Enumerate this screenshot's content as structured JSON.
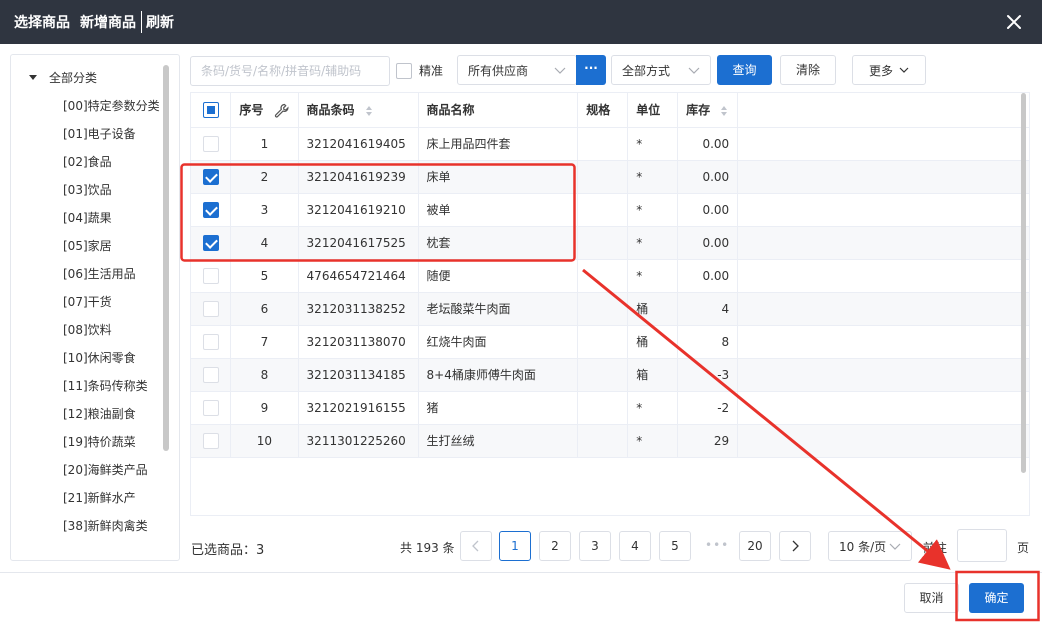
{
  "title": {
    "select": "选择商品",
    "add": "新增商品",
    "refresh": "刷新"
  },
  "sidebar": {
    "root": "全部分类",
    "items": [
      "[00]特定参数分类",
      "[01]电子设备",
      "[02]食品",
      "[03]饮品",
      "[04]蔬果",
      "[05]家居",
      "[06]生活用品",
      "[07]干货",
      "[08]饮料",
      "[10]休闲零食",
      "[11]条码传称类",
      "[12]粮油副食",
      "[19]特价蔬菜",
      "[20]海鲜类产品",
      "[21]新鲜水产",
      "[38]新鲜肉禽类"
    ]
  },
  "toolbar": {
    "search_placeholder": "条码/货号/名称/拼音码/辅助码",
    "exact_label": "精准",
    "supplier": "所有供应商",
    "supplier_more": "···",
    "method": "全部方式",
    "query": "查询",
    "clear": "清除",
    "more": "更多"
  },
  "table": {
    "headers": {
      "seq": "序号",
      "code": "商品条码",
      "name": "商品名称",
      "spec": "规格",
      "unit": "单位",
      "stock": "库存"
    },
    "rows": [
      {
        "checked": false,
        "seq": "1",
        "code": "3212041619405",
        "name": "床上用品四件套",
        "spec": "",
        "unit": "*",
        "stock": "0.00"
      },
      {
        "checked": true,
        "seq": "2",
        "code": "3212041619239",
        "name": "床单",
        "spec": "",
        "unit": "*",
        "stock": "0.00"
      },
      {
        "checked": true,
        "seq": "3",
        "code": "3212041619210",
        "name": "被单",
        "spec": "",
        "unit": "*",
        "stock": "0.00"
      },
      {
        "checked": true,
        "seq": "4",
        "code": "3212041617525",
        "name": "枕套",
        "spec": "",
        "unit": "*",
        "stock": "0.00"
      },
      {
        "checked": false,
        "seq": "5",
        "code": "4764654721464",
        "name": "随便",
        "spec": "",
        "unit": "*",
        "stock": "0.00"
      },
      {
        "checked": false,
        "seq": "6",
        "code": "3212031138252",
        "name": "老坛酸菜牛肉面",
        "spec": "",
        "unit": "桶",
        "stock": "4"
      },
      {
        "checked": false,
        "seq": "7",
        "code": "3212031138070",
        "name": "红烧牛肉面",
        "spec": "",
        "unit": "桶",
        "stock": "8"
      },
      {
        "checked": false,
        "seq": "8",
        "code": "3212031134185",
        "name": "8+4桶康师傅牛肉面",
        "spec": "",
        "unit": "箱",
        "stock": "-3"
      },
      {
        "checked": false,
        "seq": "9",
        "code": "3212021916155",
        "name": "猪",
        "spec": "",
        "unit": "*",
        "stock": "-2"
      },
      {
        "checked": false,
        "seq": "10",
        "code": "3211301225260",
        "name": "生打丝绒",
        "spec": "",
        "unit": "*",
        "stock": "29"
      }
    ]
  },
  "footer": {
    "selected": "已选商品：3",
    "total": "共 193 条",
    "pages": [
      "1",
      "2",
      "3",
      "4",
      "5"
    ],
    "ellipsis": "•••",
    "last_page": "20",
    "page_size": "10 条/页",
    "goto": "前往",
    "page_unit": "页",
    "cancel": "取消",
    "confirm": "确定"
  },
  "colors": {
    "primary": "#1c6fd1",
    "titlebar": "#2f3540",
    "annotation": "#e8322b"
  },
  "icons": [
    "close-icon",
    "caret-down-icon",
    "wrench-icon",
    "sort-icon",
    "chevron-down-icon",
    "chevron-left-icon",
    "chevron-right-icon"
  ]
}
